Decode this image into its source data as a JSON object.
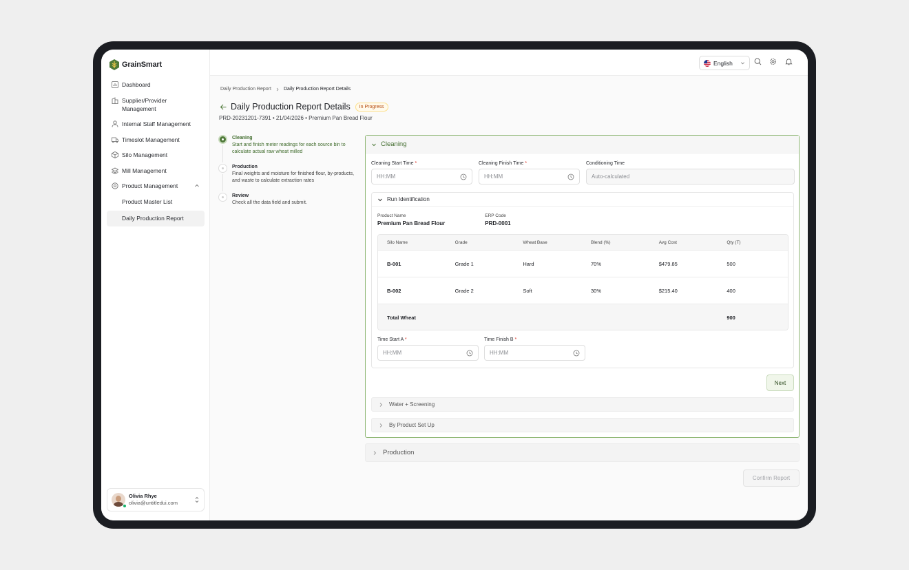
{
  "app": {
    "name": "GrainSmart"
  },
  "sidebar": {
    "items": [
      {
        "label": "Dashboard"
      },
      {
        "label": "Supplier/Provider Management"
      },
      {
        "label": "Internal Staff Management"
      },
      {
        "label": "Timeslot Management"
      },
      {
        "label": "Silo Management"
      },
      {
        "label": "Mill Management"
      },
      {
        "label": "Product Management"
      }
    ],
    "sub_items": [
      {
        "label": "Product Master List"
      },
      {
        "label": "Daily Production Report"
      }
    ]
  },
  "user": {
    "name": "Olivia Rhye",
    "email": "olivia@untitledui.com"
  },
  "topbar": {
    "language": "English"
  },
  "breadcrumb": {
    "parent": "Daily Production Report",
    "current": "Daily Production Report Details"
  },
  "page": {
    "title": "Daily Production Report Details",
    "status": "In Progress",
    "subtitle": "PRD-20231201-7391 • 21/04/2026 • Premium Pan Bread Flour"
  },
  "steps": [
    {
      "title": "Cleaning",
      "desc": "Start and finish meter readings for each source bin to calculate actual raw wheat milled"
    },
    {
      "title": "Production",
      "desc": "Final weights and moisture for finished flour, by-products, and waste to calculate extraction rates"
    },
    {
      "title": "Review",
      "desc": "Check all the data field and submit."
    }
  ],
  "cleaning": {
    "title": "Cleaning",
    "start_label": "Cleaning Start Time",
    "start_placeholder": "HH:MM",
    "finish_label": "Cleaning Finish Time",
    "finish_placeholder": "HH:MM",
    "cond_label": "Conditioning Time",
    "cond_placeholder": "Auto-calculated"
  },
  "run": {
    "title": "Run Identification",
    "product_label": "Product Name",
    "product_value": "Premium Pan Bread Flour",
    "erp_label": "ERP Code",
    "erp_value": "PRD-0001",
    "columns": [
      "Silo Name",
      "Grade",
      "Wheat Base",
      "Blend (%)",
      "Avg Cost",
      "Qty (T)"
    ],
    "rows": [
      [
        "B-001",
        "Grade 1",
        "Hard",
        "70%",
        "$479.85",
        "500"
      ],
      [
        "B-002",
        "Grade 2",
        "Soft",
        "30%",
        "$215.40",
        "400"
      ]
    ],
    "total_label": "Total Wheat",
    "total_value": "900",
    "time_a_label": "Time Start A",
    "time_a_placeholder": "HH:MM",
    "time_b_label": "Time Finish B",
    "time_b_placeholder": "HH:MM"
  },
  "buttons": {
    "next": "Next",
    "confirm": "Confirm Report"
  },
  "accordions": {
    "water": "Water + Screening",
    "byproduct": "By Product Set Up",
    "production": "Production"
  },
  "colors": {
    "brand": "#4f7a3a",
    "accent_border": "#8fb775",
    "status": "#b54708"
  },
  "icons": [
    "logo-icon",
    "grid-icon",
    "building-icon",
    "user-icon",
    "truck-icon",
    "box-icon",
    "layers-icon",
    "package-icon",
    "search-icon",
    "gear-icon",
    "bell-icon",
    "clock-icon",
    "chevron-down-icon",
    "chevron-right-icon",
    "arrow-left-icon",
    "flag-icon"
  ]
}
